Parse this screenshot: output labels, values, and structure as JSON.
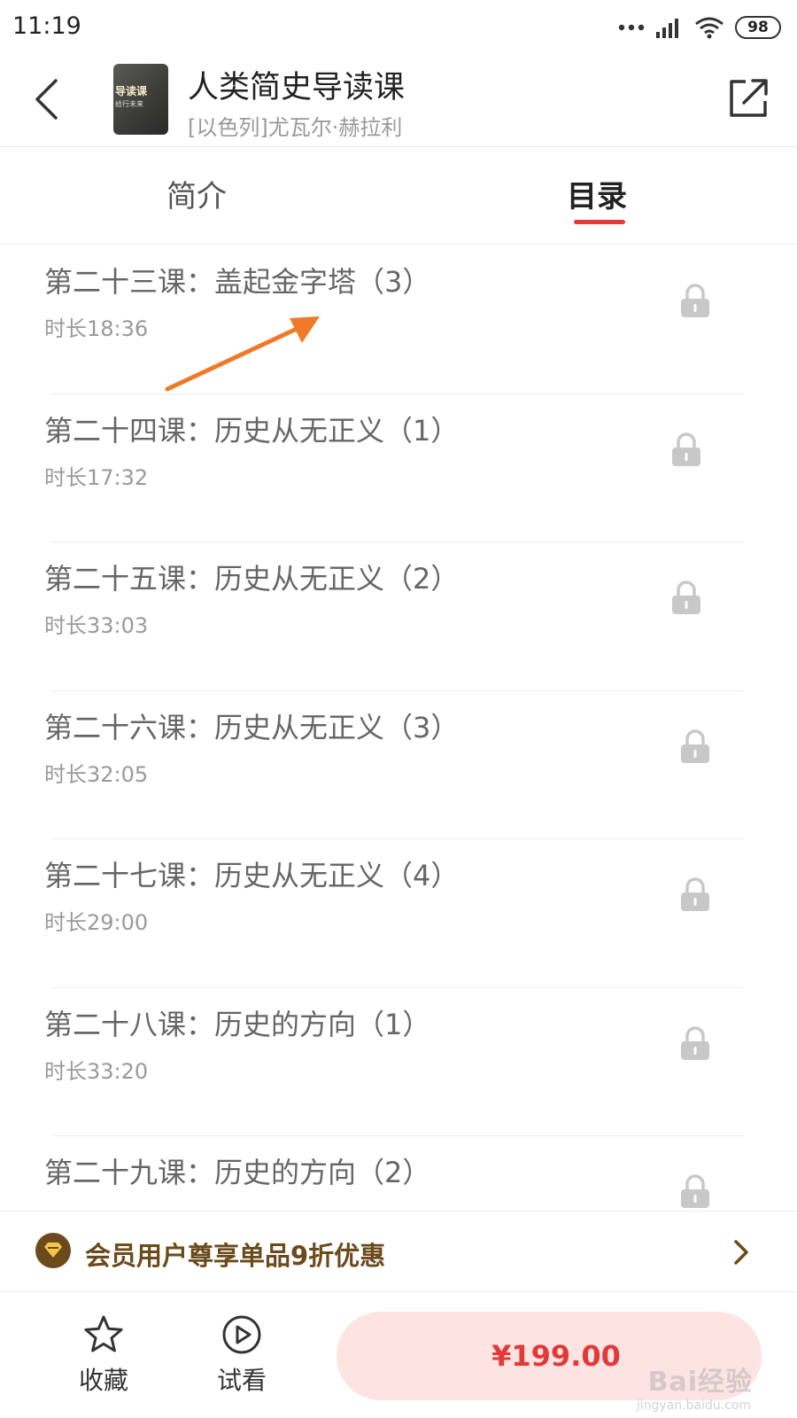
{
  "status_bar": {
    "time": "11:19",
    "battery": "98",
    "icons": [
      "more-dots-icon",
      "signal-icon",
      "wifi-icon",
      "battery-icon"
    ]
  },
  "header": {
    "title": "人类简史导读课",
    "author": "[以色列]尤瓦尔·赫拉利",
    "cover_text": "导读课",
    "cover_subtext": "给行未来",
    "icons": [
      "back-icon",
      "share-icon"
    ]
  },
  "tabs": [
    {
      "label": "简介",
      "active": false
    },
    {
      "label": "目录",
      "active": true
    }
  ],
  "lessons": [
    {
      "title": "第二十三课：盖起金字塔（3）",
      "duration": "时长18:36",
      "locked": true
    },
    {
      "title": "第二十四课：历史从无正义（1）",
      "duration": "时长17:32",
      "locked": true
    },
    {
      "title": "第二十五课：历史从无正义（2）",
      "duration": "时长33:03",
      "locked": true
    },
    {
      "title": "第二十六课：历史从无正义（3）",
      "duration": "时长32:05",
      "locked": true
    },
    {
      "title": "第二十七课：历史从无正义（4）",
      "duration": "时长29:00",
      "locked": true
    },
    {
      "title": "第二十八课：历史的方向（1）",
      "duration": "时长33:20",
      "locked": true
    },
    {
      "title": "第二十九课：历史的方向（2）",
      "duration": "",
      "locked": true
    }
  ],
  "promo": {
    "text": "会员用户尊享单品9折优惠",
    "icon": "vip-diamond-icon"
  },
  "bottom_bar": {
    "favorite_label": "收藏",
    "trial_label": "试看",
    "price": "¥199.00"
  },
  "watermark": {
    "text": "Bai经验",
    "url": "jingyan.baidu.com"
  },
  "colors": {
    "accent": "#e03a3a",
    "buy_button_bg": "#fde3e2",
    "promo_text": "#6b4a1c",
    "arrow": "#f07a2a"
  }
}
